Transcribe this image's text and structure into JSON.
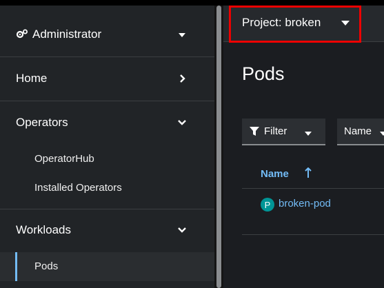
{
  "sidebar": {
    "perspective": {
      "label": "Administrator",
      "icon": "cogs-icon",
      "chevron": "caret-down-icon"
    },
    "items": [
      {
        "label": "Home",
        "icon": "chevron-right-icon"
      },
      {
        "label": "Operators",
        "icon": "chevron-down-icon"
      },
      {
        "label": "Workloads",
        "icon": "chevron-down-icon"
      }
    ],
    "operators_sub": [
      "OperatorHub",
      "Installed Operators"
    ],
    "workloads_sub": [
      "Pods"
    ]
  },
  "project": {
    "label": "Project: broken",
    "icon": "caret-down-icon"
  },
  "page": {
    "title": "Pods"
  },
  "toolbar": {
    "filter_label": "Filter",
    "name_label": "Name"
  },
  "table": {
    "columns": [
      "Name"
    ],
    "rows": [
      {
        "badge": "P",
        "name": "broken-pod"
      }
    ]
  },
  "colors": {
    "highlight": "#ee0000",
    "link": "#73bcf7",
    "badge": "#009596"
  }
}
